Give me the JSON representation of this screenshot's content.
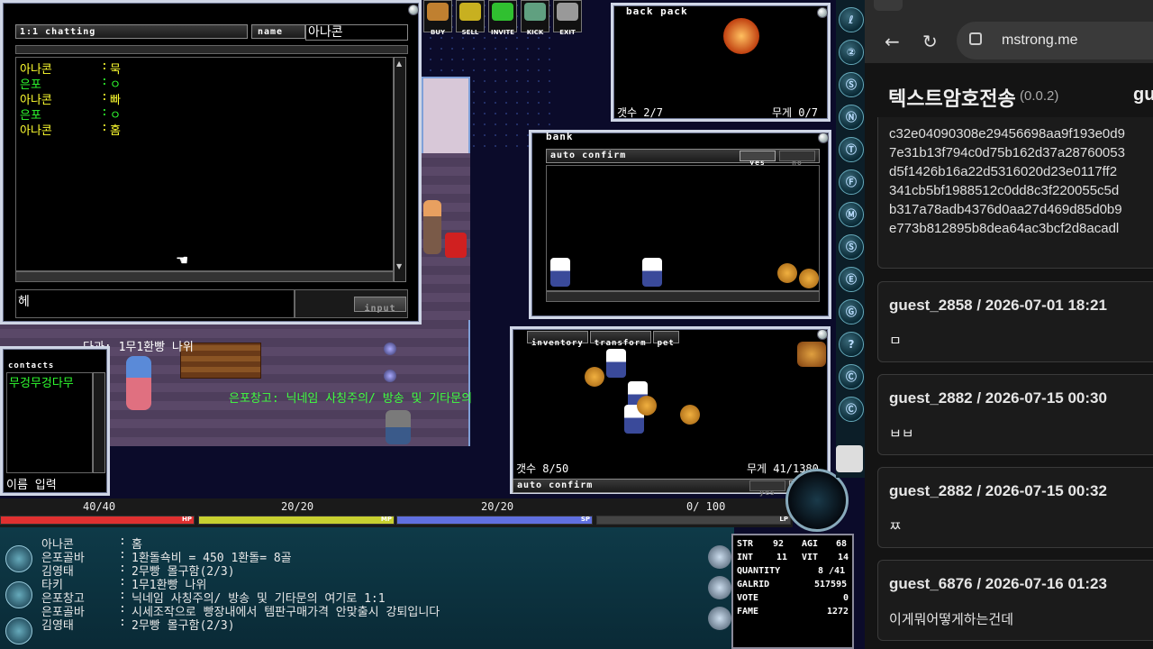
{
  "game": {
    "chat_window": {
      "title": "1:1 chatting",
      "name_label": "name",
      "name_value": "아나콘",
      "messages": [
        {
          "speaker": "아나콘",
          "sep": ":",
          "text": "묵",
          "color": "#ffff30"
        },
        {
          "speaker": "은포",
          "sep": ":",
          "text": "ㅇ",
          "color": "#30ff30"
        },
        {
          "speaker": "아나콘",
          "sep": ":",
          "text": "빠",
          "color": "#ffff30"
        },
        {
          "speaker": "은포",
          "sep": ":",
          "text": "ㅇ",
          "color": "#30ff30"
        },
        {
          "speaker": "아나콘",
          "sep": ":",
          "text": "홈",
          "color": "#ffff30"
        }
      ],
      "input_value": "헤",
      "input_button": "input"
    },
    "toolbar": [
      {
        "label": "BUY",
        "icon": "bucket-icon",
        "color": "#c08030"
      },
      {
        "label": "SELL",
        "icon": "money-bag-icon",
        "color": "#c8b020"
      },
      {
        "label": "INVITE",
        "icon": "frog-icon",
        "color": "#30c030"
      },
      {
        "label": "KICK",
        "icon": "boot-icon",
        "color": "#60a080"
      },
      {
        "label": "EXIT",
        "icon": "exit-icon",
        "color": "#999999"
      }
    ],
    "backpack": {
      "title": "back pack",
      "count_label": "갯수 2/7",
      "weight_label": "무게 0/7"
    },
    "bank": {
      "title": "bank",
      "auto_confirm": "auto confirm",
      "yes": "yes",
      "no": "no"
    },
    "inventory": {
      "tabs": [
        "inventory",
        "transform",
        "pet"
      ],
      "count_label": "갯수 8/50",
      "weight_label": "무게 41/1380",
      "auto_confirm": "auto confirm",
      "yes": "yes",
      "no": "no"
    },
    "contacts": {
      "title": "contacts",
      "items": [
        "무겅무겅다무"
      ],
      "name_input": "이름 입력"
    },
    "overhead": {
      "npc_text": "다과: 1무1환빵 나위",
      "shop_text": "은포창고: 닉네임 사칭주의/ 방송 및 기타문의"
    },
    "bars": [
      {
        "label": "40/40",
        "tag": "HP",
        "color": "#e03030"
      },
      {
        "label": "20/20",
        "tag": "MP",
        "color": "#c8d030"
      },
      {
        "label": "20/20",
        "tag": "SP",
        "color": "#6070e0"
      },
      {
        "label": "0/ 100",
        "tag": "LP",
        "color": "#444444"
      }
    ],
    "log": [
      {
        "name": "아나콘",
        "text": "홈"
      },
      {
        "name": "은포골바",
        "text": "1환돌쇽비 = 450 1환돌= 8골"
      },
      {
        "name": "김영태",
        "text": "2무빵 몰구함(2/3)"
      },
      {
        "name": "타키",
        "text": "1무1환빵 나위"
      },
      {
        "name": "은포창고",
        "text": "닉네임 사칭주의/ 방송 및 기타문의 여기로 1:1"
      },
      {
        "name": "은포골바",
        "text": "시세조작으로 빵장내에서 템판구매가격 안맞출시 강퇴입니다"
      },
      {
        "name": "김영태",
        "text": "2무빵 몰구함(2/3)"
      }
    ],
    "stats": {
      "str_label": "STR",
      "str": "92",
      "agi_label": "AGI",
      "agi": "68",
      "int_label": "INT",
      "int": "11",
      "vit_label": "VIT",
      "vit": "14",
      "quantity_label": "QUANTITY",
      "quantity": "8 /41",
      "galrid_label": "GALRID",
      "galrid": "517595",
      "vote_label": "VOTE",
      "vote": "0",
      "fame_label": "FAME",
      "fame": "1272"
    },
    "side_icons": [
      "ℓ",
      "②",
      "Ⓢ",
      "Ⓝ",
      "Ⓣ",
      "Ⓕ",
      "Ⓜ",
      "Ⓢ",
      "Ⓔ",
      "Ⓖ",
      "?",
      "Ⓒ",
      "Ⓒ"
    ]
  },
  "browser": {
    "url": "mstrong.me",
    "page_title": "텍스트암호전송",
    "version": "(0.0.2)",
    "title_right": "gu",
    "hex_lines": [
      "c32e04090308e29456698aa9f193e0d9",
      "7e31b13f794c0d75b162d37a28760053",
      "d5f1426b16a22d5316020d23e0117ff2",
      "341cb5bf1988512c0dd8c3f220055c5d",
      "b317a78adb4376d0aa27d469d85d0b9",
      "e773b812895b8dea64ac3bcf2d8acadl"
    ],
    "posts": [
      {
        "header": "guest_2858 / 2026-07-01 18:21",
        "body": "ㅁ"
      },
      {
        "header": "guest_2882 / 2026-07-15 00:30",
        "body": "ㅂㅂ"
      },
      {
        "header": "guest_2882 / 2026-07-15 00:32",
        "body": "ㅉ"
      },
      {
        "header": "guest_6876 / 2026-07-16 01:23",
        "body": "이게뭐어떻게하는건데"
      }
    ]
  }
}
